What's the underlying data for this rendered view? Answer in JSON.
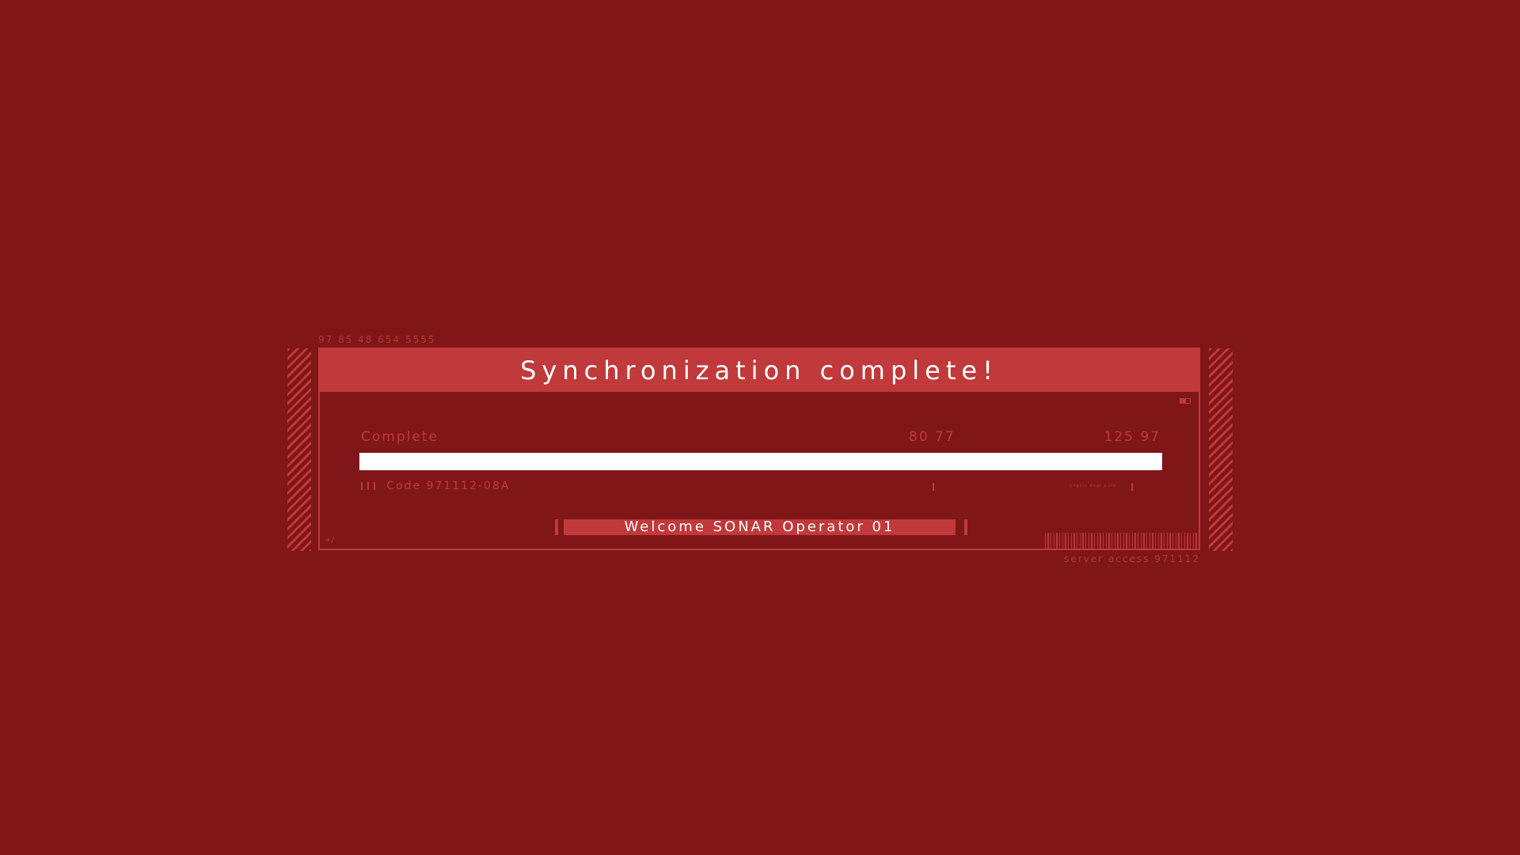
{
  "top_code": "97 85 48 654 5555",
  "title": "Synchronization complete!",
  "progress": {
    "label": "Complete",
    "value_1": "80 77",
    "value_2": "125 97",
    "fill_fraction": 1.0
  },
  "code_text": "Code 971112-08A",
  "tiny_text": "Cognis engr auth",
  "welcome": "Welcome SONAR Operator 01",
  "corner_text": "+/",
  "server_access": "server access 971112",
  "colors": {
    "background": "#7f1617",
    "accent": "#c0393b",
    "fill": "#ffffff"
  }
}
